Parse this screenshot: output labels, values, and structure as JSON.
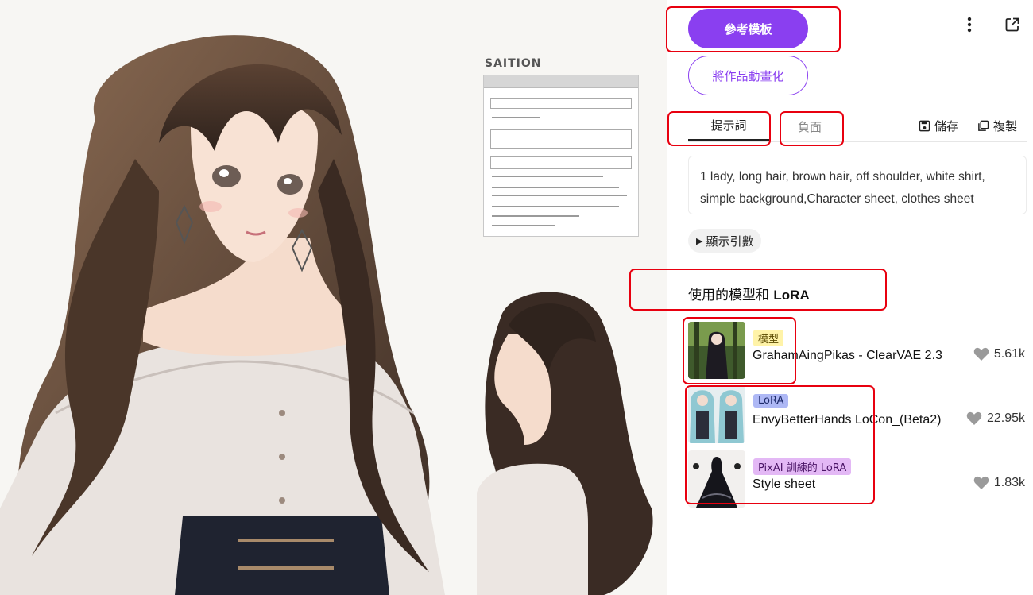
{
  "artwork": {
    "sheet_title": "SAITION"
  },
  "actions": {
    "reference_template": "參考模板",
    "animate_work": "將作品動畫化"
  },
  "tabs": {
    "prompt": "提示詞",
    "negative": "負面",
    "save": "儲存",
    "copy": "複製"
  },
  "prompt_text": "1 lady, long hair, brown hair, off shoulder, white shirt, simple background,Character sheet, clothes sheet",
  "show_index": "顯示引數",
  "models_section": {
    "title_prefix": "使用的模型和 ",
    "title_bold": "LoRA",
    "items": [
      {
        "badge": "模型",
        "badge_color": "#fff3a8",
        "name": "GrahamAingPikas - ClearVAE 2.3",
        "likes": "5.61k"
      },
      {
        "badge": "LoRA",
        "badge_color": "#aeb8f5",
        "name": "EnvyBetterHands LoCon_(Beta2)",
        "likes": "22.95k"
      },
      {
        "badge": "PixAI 訓練的 LoRA",
        "badge_color": "#e3b8f5",
        "name": "Style sheet",
        "likes": "1.83k"
      }
    ]
  },
  "colors": {
    "accent": "#8a3ff0",
    "annotation": "#e8000f"
  }
}
